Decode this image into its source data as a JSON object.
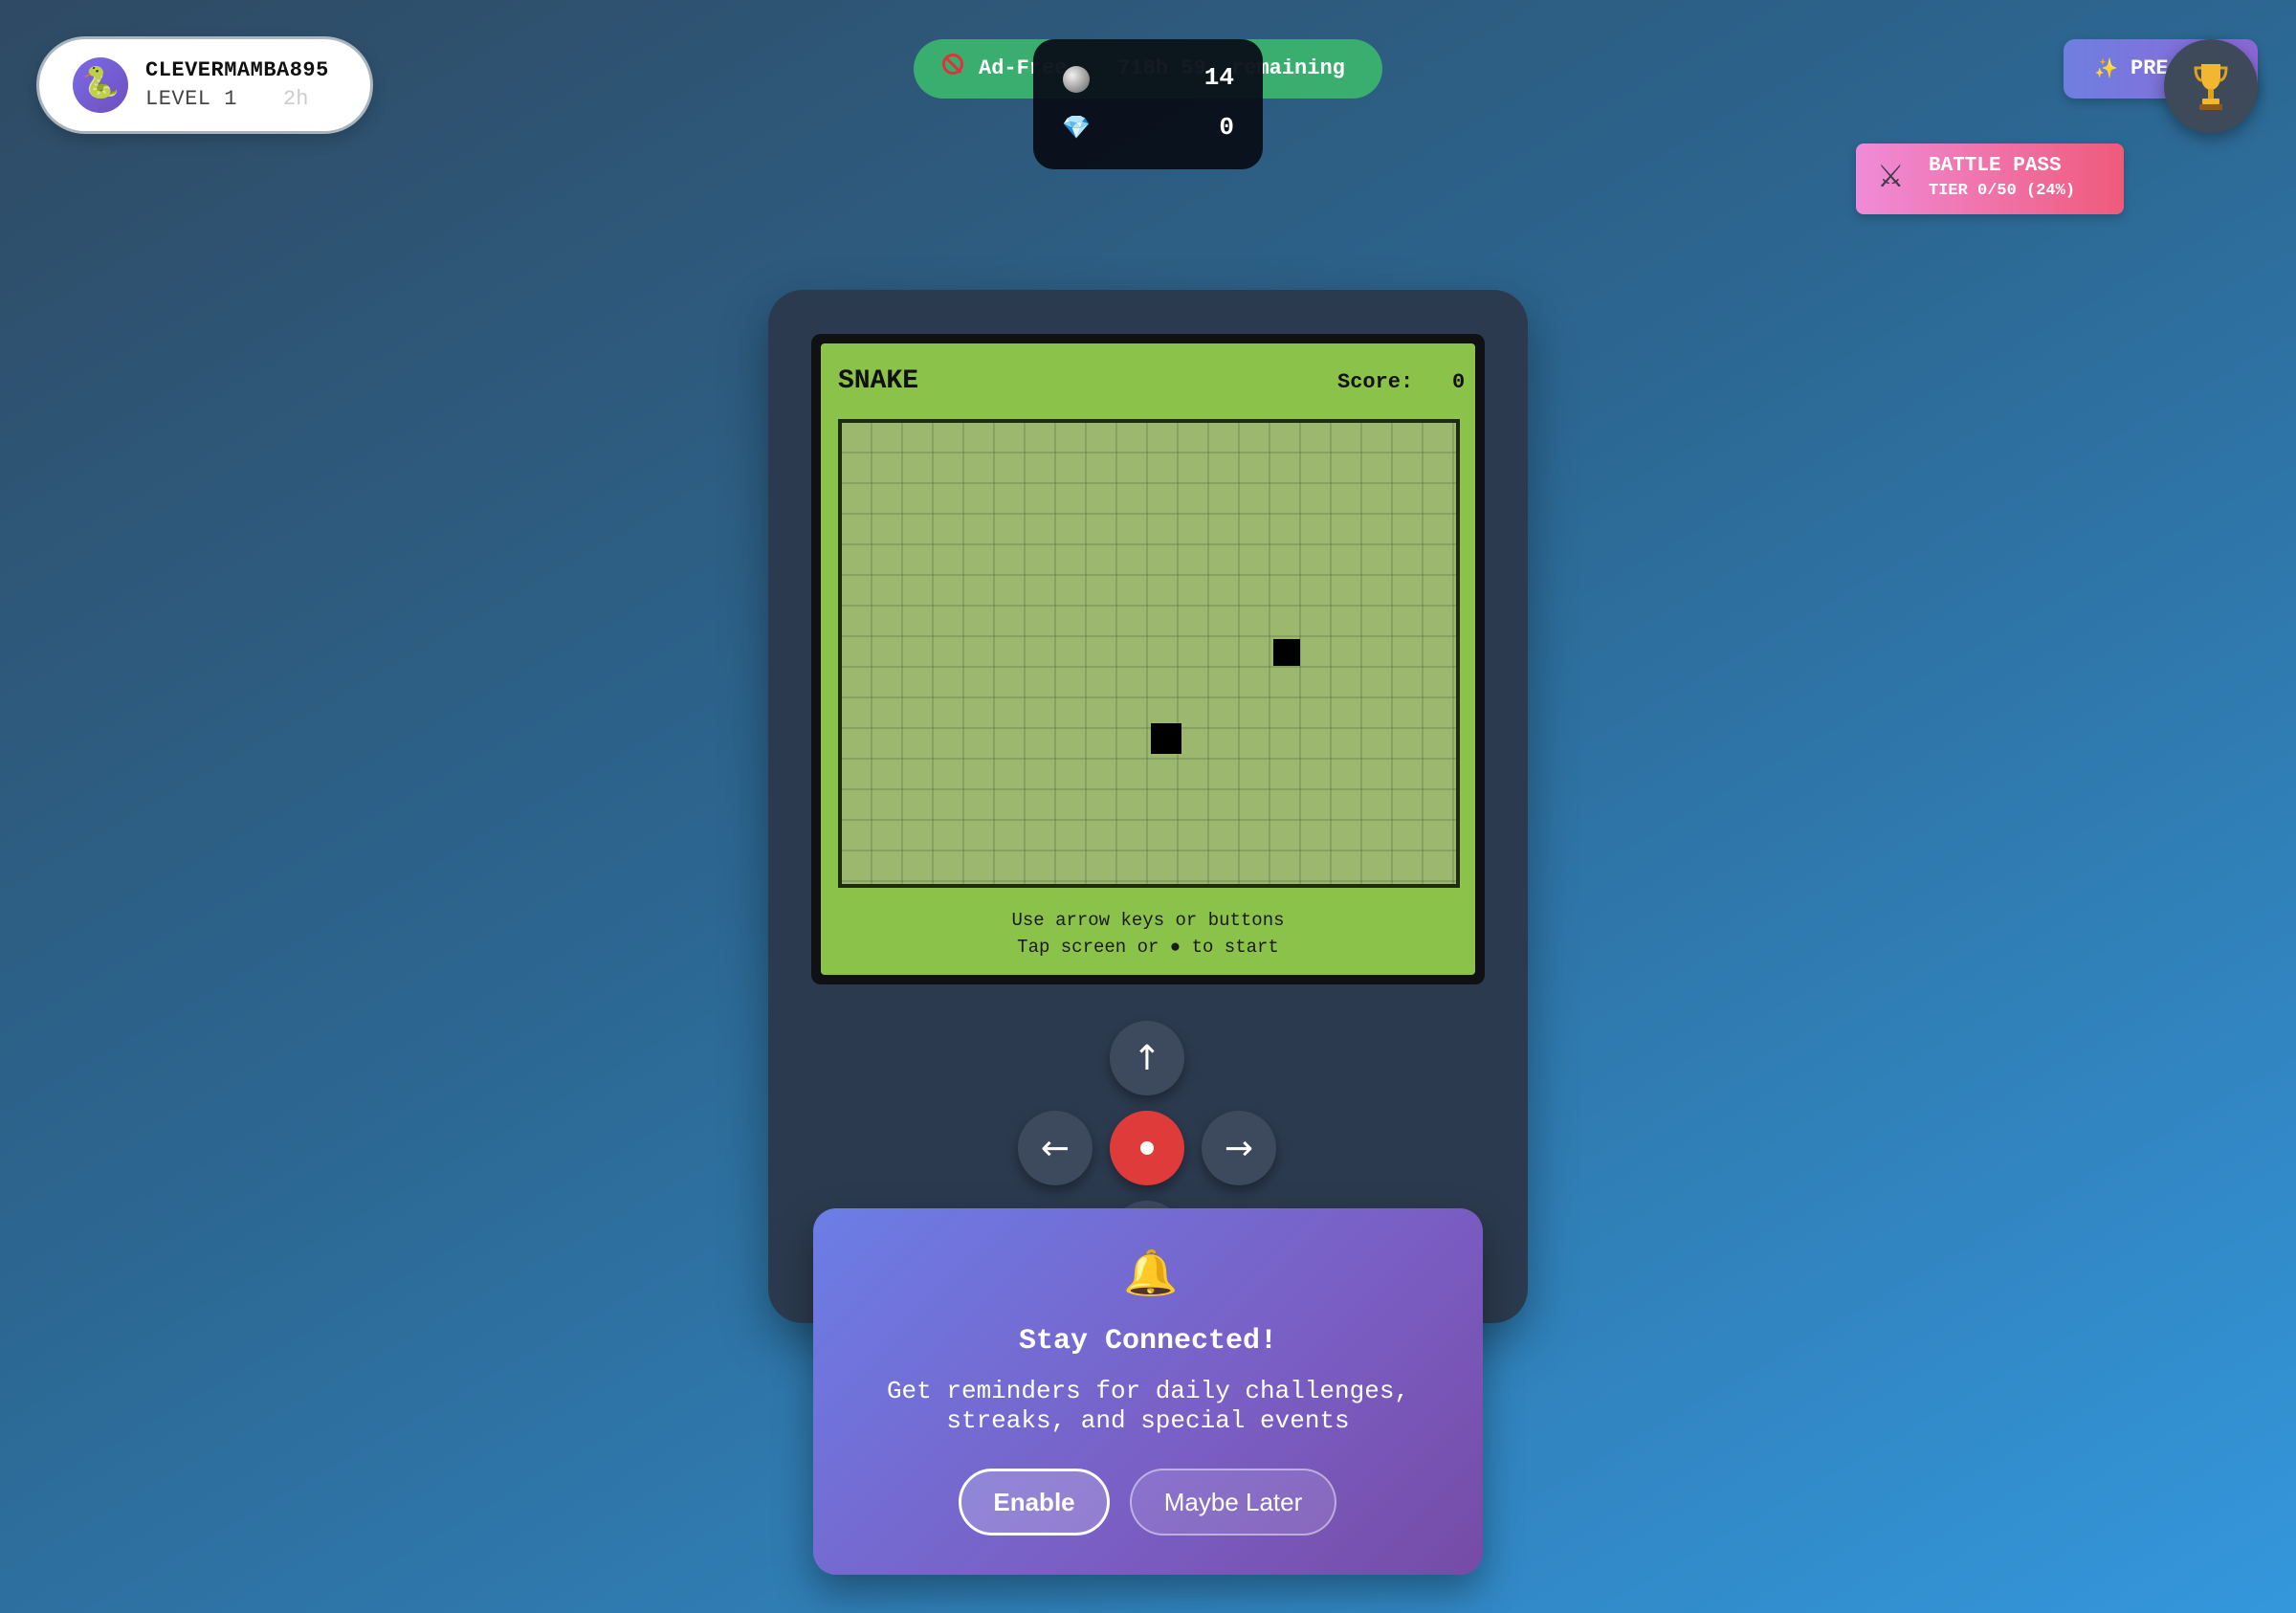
{
  "player": {
    "avatar_icon": "snake-icon",
    "avatar_glyph": "🐍",
    "name": "CLEVERMAMBA895",
    "level": "LEVEL 1",
    "level_ghost": "2h"
  },
  "ad_free": {
    "icon": "no-ads-icon",
    "text": "Ad-Free    718h 59  remaining"
  },
  "currency": {
    "coins": {
      "icon": "coin-icon",
      "value": "14"
    },
    "gems": {
      "icon": "gem-icon",
      "glyph": "💎",
      "value": "0"
    }
  },
  "premium": {
    "icon": "sparkle-icon",
    "glyph": "✨",
    "label": "PRE"
  },
  "trophy": {
    "icon": "trophy-icon"
  },
  "battle_pass": {
    "icon": "crossed-swords-icon",
    "glyph": "⚔",
    "title": "BATTLE PASS",
    "tier": "TIER 0/50 (24%)"
  },
  "game": {
    "title": "SNAKE",
    "score_label": "Score:",
    "score": "0",
    "instructions": [
      "Use arrow keys or buttons",
      "Tap screen or ● to start"
    ],
    "screen_color": "#8bc34a",
    "board_color": "#9cb86f"
  },
  "controls": {
    "up": "↑",
    "left": "←",
    "right": "→",
    "center_color": "#e03b3b"
  },
  "notification": {
    "icon": "bell-icon",
    "glyph": "🔔",
    "title": "Stay Connected!",
    "body": "Get reminders for daily challenges, streaks, and special events",
    "enable_label": "Enable",
    "later_label": "Maybe Later"
  }
}
